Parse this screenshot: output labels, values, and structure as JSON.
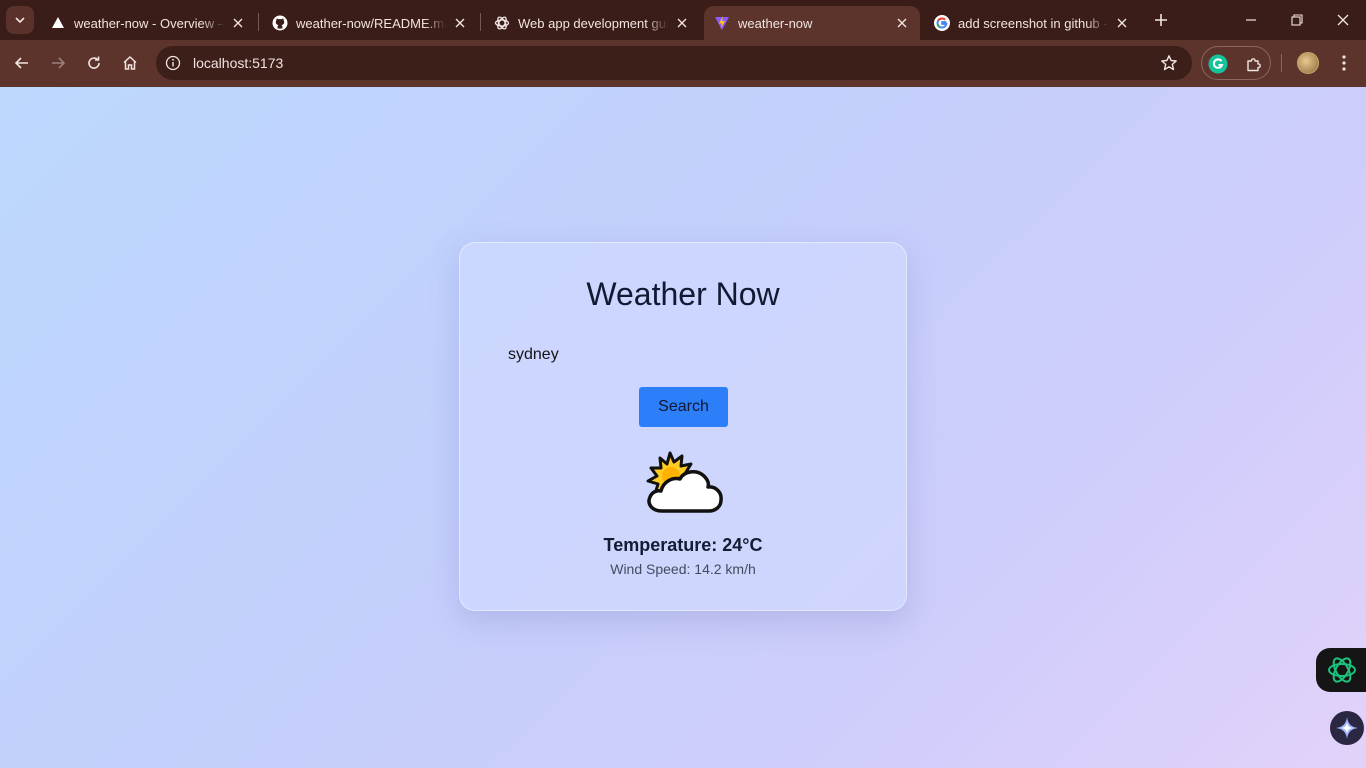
{
  "browser": {
    "tabs": [
      {
        "title": "weather-now - Overview – Vercel",
        "favicon": "vercel-icon",
        "active": false
      },
      {
        "title": "weather-now/README.md at main",
        "favicon": "github-icon",
        "active": false
      },
      {
        "title": "Web app development guide",
        "favicon": "chatgpt-icon",
        "active": false
      },
      {
        "title": "weather-now",
        "favicon": "vite-icon",
        "active": true
      },
      {
        "title": "add screenshot in github - Google Search",
        "favicon": "google-icon",
        "active": false
      }
    ],
    "address": "localhost:5173",
    "extensions": [
      "grammarly-icon",
      "puzzle-icon"
    ]
  },
  "app": {
    "title": "Weather Now",
    "city_value": "sydney",
    "search_label": "Search",
    "weather_icon": "partly-cloudy-icon",
    "temperature": "Temperature: 24°C",
    "wind": "Wind Speed: 14.2 km/h"
  },
  "colors": {
    "accent": "#2c7ff8",
    "title": "#121a33",
    "browser_frame": "#3a1d18"
  }
}
